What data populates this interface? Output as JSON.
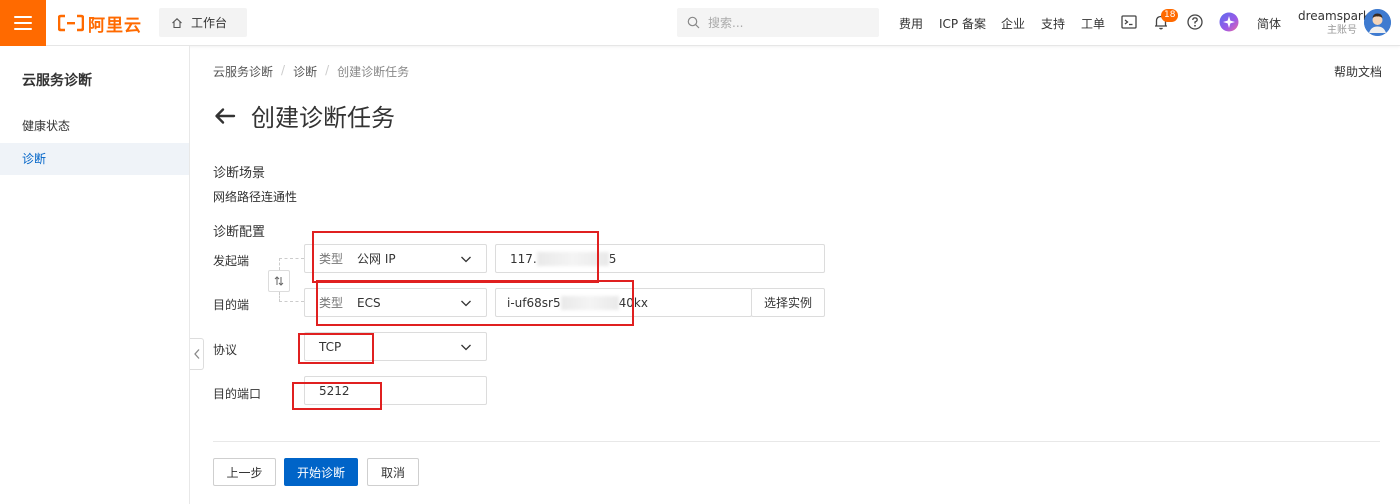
{
  "topbar": {
    "logo_text": "阿里云",
    "workbench_label": "工作台",
    "search_placeholder": "搜索...",
    "nav": [
      "费用",
      "ICP 备案",
      "企业",
      "支持",
      "工单"
    ],
    "notification_count": "18",
    "language": "简体",
    "user_name": "dreamspark",
    "user_role": "主账号",
    "brand_color": "#ff6a00"
  },
  "sidebar": {
    "title": "云服务诊断",
    "items": [
      {
        "label": "健康状态",
        "active": false
      },
      {
        "label": "诊断",
        "active": true
      }
    ]
  },
  "breadcrumb": [
    "云服务诊断",
    "诊断",
    "创建诊断任务"
  ],
  "help_docs": "帮助文档",
  "page_title": "创建诊断任务",
  "scenario": {
    "label": "诊断场景",
    "value": "网络路径连通性"
  },
  "config": {
    "label": "诊断配置",
    "source": {
      "label": "发起端",
      "type_prefix": "类型",
      "type_value": "公网 IP",
      "ip_start": "117.",
      "ip_end": "5"
    },
    "target": {
      "label": "目的端",
      "type_prefix": "类型",
      "type_value": "ECS",
      "instance_start": "i-uf68sr5",
      "instance_end": "40kx",
      "select_instance": "选择实例"
    },
    "protocol": {
      "label": "协议",
      "value": "TCP"
    },
    "port": {
      "label": "目的端口",
      "value": "5212"
    }
  },
  "footer": {
    "prev": "上一步",
    "start": "开始诊断",
    "cancel": "取消"
  },
  "colors": {
    "primary": "#0064c8",
    "highlight_box": "#e02020"
  }
}
